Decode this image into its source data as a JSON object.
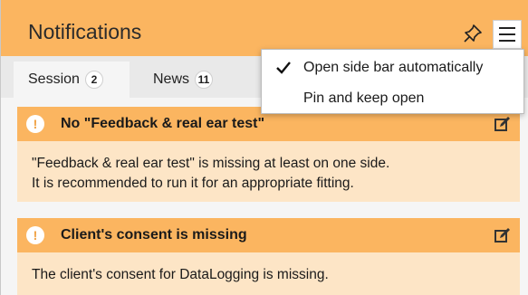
{
  "header": {
    "title": "Notifications",
    "pin_icon": "pin-icon",
    "menu_icon": "hamburger-menu-icon"
  },
  "tabs": [
    {
      "label": "Session",
      "count": "2",
      "active": true
    },
    {
      "label": "News",
      "count": "11",
      "active": false
    }
  ],
  "cards": [
    {
      "title": "No \"Feedback & real ear test\"",
      "body_lines": [
        "\"Feedback & real ear test\" is missing at least on one side.",
        "It is recommended to run it for an appropriate fitting."
      ]
    },
    {
      "title": "Client's consent is missing",
      "body_lines": [
        "The client's consent for DataLogging is missing."
      ]
    }
  ],
  "menu": {
    "items": [
      {
        "label": "Open side bar automatically",
        "checked": true
      },
      {
        "label": "Pin and keep open",
        "checked": false
      }
    ]
  },
  "colors": {
    "accent": "#fbb560",
    "card_body": "#fde5c6",
    "tab_bar": "#e9e9e9"
  }
}
